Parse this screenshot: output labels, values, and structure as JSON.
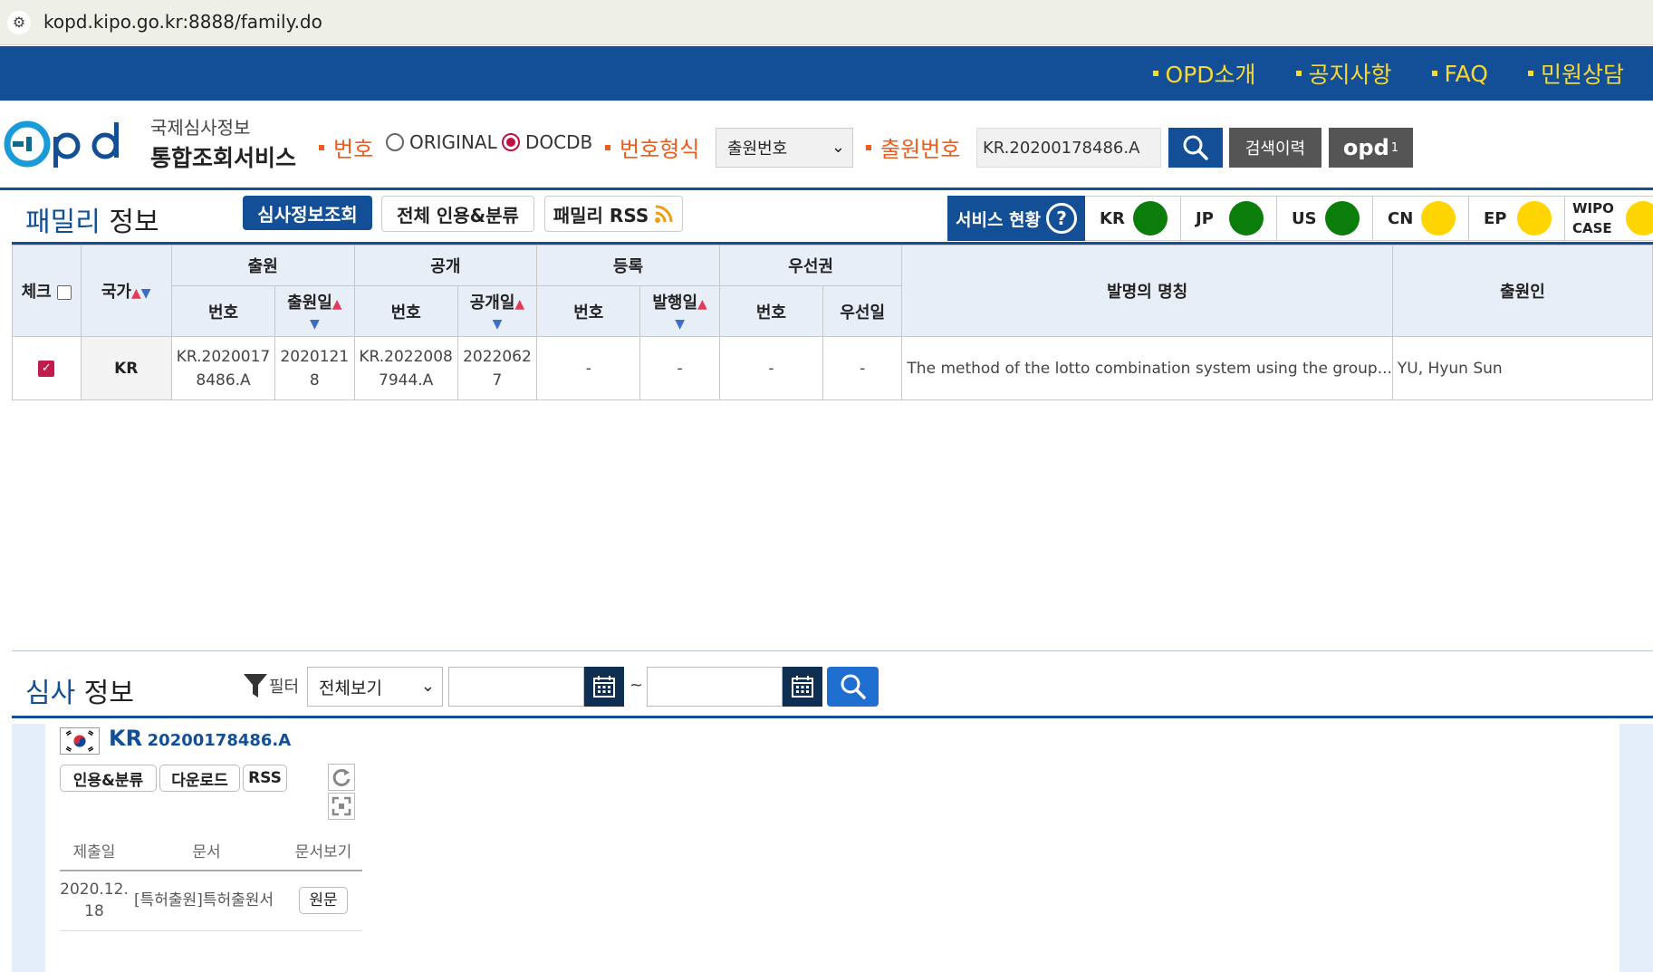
{
  "browser": {
    "url": "kopd.kipo.go.kr:8888/family.do"
  },
  "topnav": {
    "items": [
      "OPD소개",
      "공지사항",
      "FAQ",
      "민원상담"
    ]
  },
  "header": {
    "logo_sub": "국제심사정보",
    "logo_main": "통합조회서비스",
    "number_label": "번호",
    "radio_original": "ORIGINAL",
    "radio_docdb": "DOCDB",
    "format_label": "번호형식",
    "format_select": "출원번호",
    "app_no_label": "출원번호",
    "search_value": "KR.20200178486.A",
    "history_btn": "검색이력",
    "opd1_btn": "opd",
    "opd1_sup": "1"
  },
  "family": {
    "title_a": "패밀리",
    "title_b": "정보",
    "btn_exam": "심사정보조회",
    "btn_cite": "전체 인용&분류",
    "btn_rss": "패밀리 RSS",
    "service_title": "서비스 현황",
    "service_q": "?",
    "services": [
      {
        "code": "KR",
        "color": "#0a7d0a"
      },
      {
        "code": "JP",
        "color": "#0a7d0a"
      },
      {
        "code": "US",
        "color": "#0a7d0a"
      },
      {
        "code": "CN",
        "color": "#ffd500"
      },
      {
        "code": "EP",
        "color": "#ffd500"
      },
      {
        "code": "WIPO CASE",
        "color": "#ffd500"
      }
    ],
    "table": {
      "h_check": "체크",
      "h_country": "국가",
      "h_application": "출원",
      "h_publication": "공개",
      "h_registration": "등록",
      "h_priority": "우선권",
      "h_title": "발명의 명칭",
      "h_applicant": "출원인",
      "h_number": "번호",
      "h_app_date": "출원일",
      "h_pub_date": "공개일",
      "h_issue_date": "발행일",
      "h_prio_date": "우선일",
      "row": {
        "country": "KR",
        "app_no": "KR.20200178486.A",
        "app_date": "20201218",
        "pub_no": "KR.20220087944.A",
        "pub_date": "20220627",
        "reg_no": "-",
        "reg_date": "-",
        "prio_no": "-",
        "prio_date": "-",
        "title": "The method of the lotto combination system using the group...",
        "applicant": "YU, Hyun Sun"
      }
    }
  },
  "exam": {
    "title_a": "심사",
    "title_b": "정보",
    "filter_label": "필터",
    "filter_select": "전체보기",
    "tilde": "~",
    "country": "KR",
    "number": "20200178486.A",
    "btn_cite": "인용&분류",
    "btn_download": "다운로드",
    "btn_rss": "RSS",
    "table": {
      "h_date": "제출일",
      "h_doc": "문서",
      "h_view": "문서보기",
      "row_date": "2020.12.18",
      "row_doc": "[특허출원]특허출원서",
      "row_btn": "원문"
    }
  }
}
